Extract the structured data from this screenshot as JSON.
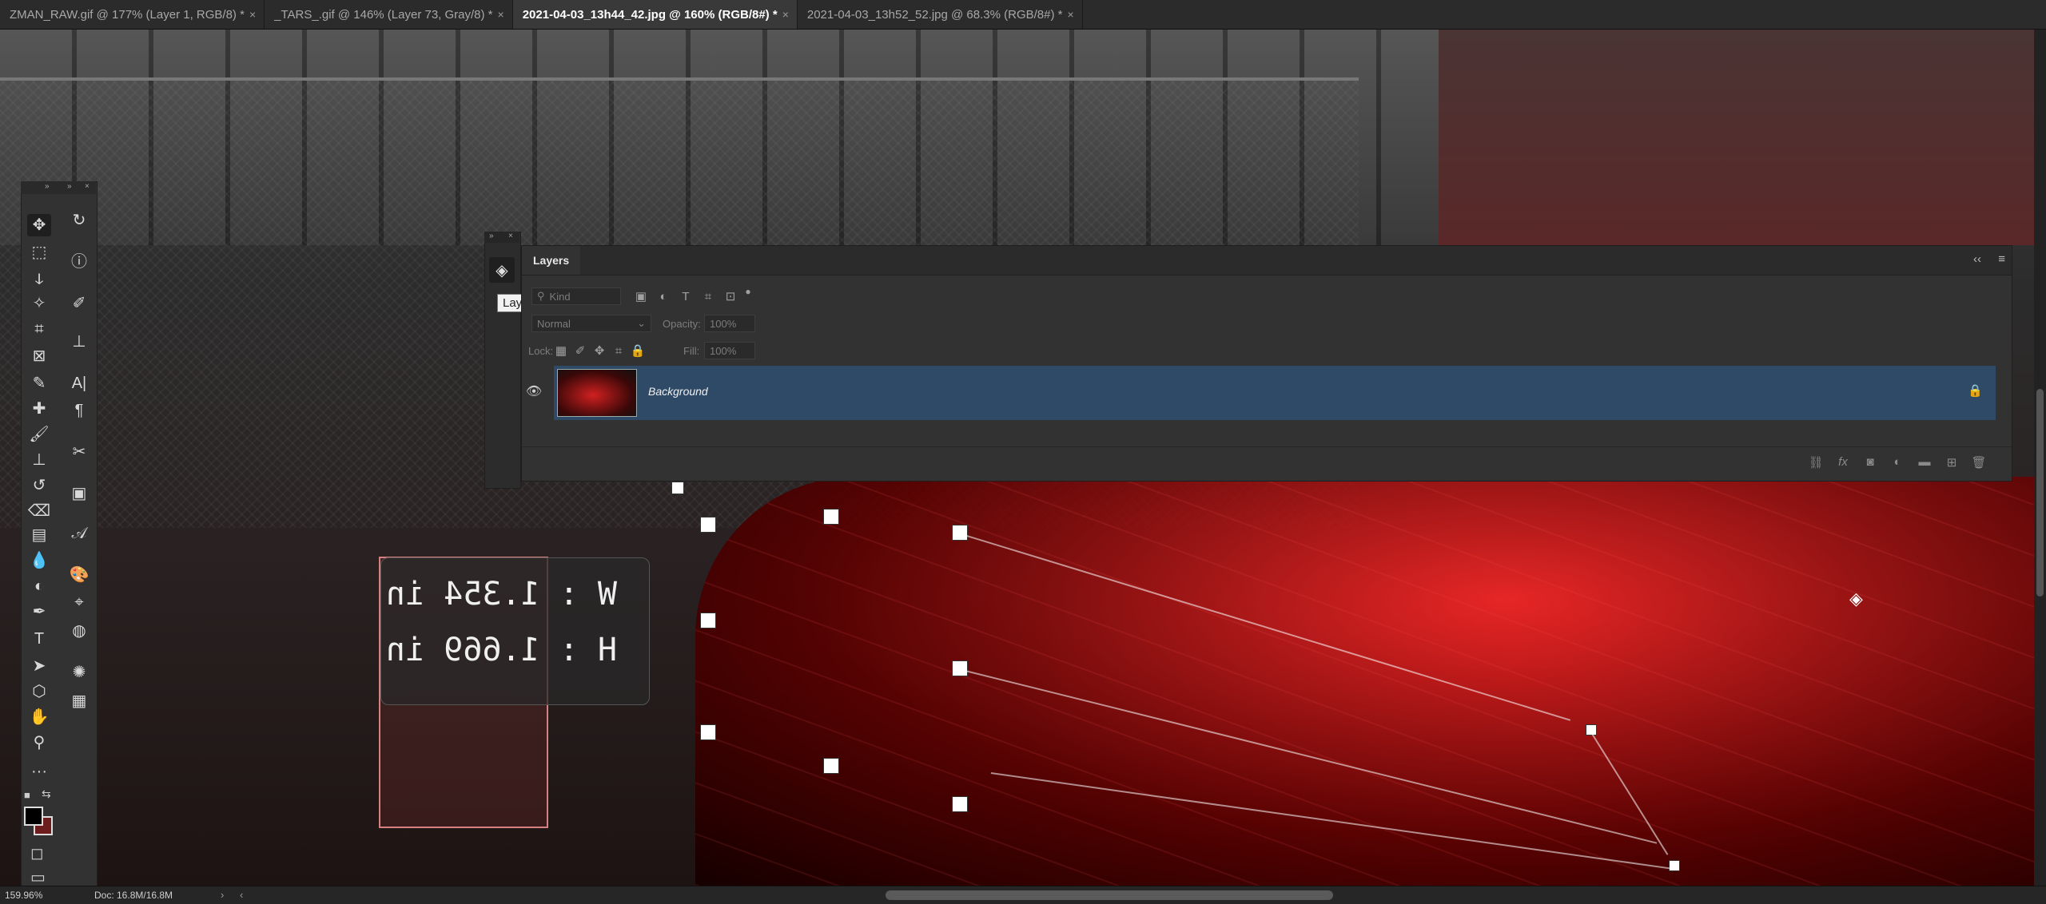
{
  "tabs": [
    {
      "label": "ZMAN_RAW.gif @ 177% (Layer 1, RGB/8) *",
      "close": "×",
      "active": false
    },
    {
      "label": "_TARS_.gif @ 146% (Layer 73, Gray/8) *",
      "close": "×",
      "active": false
    },
    {
      "label": "2021-04-03_13h44_42.jpg @ 160% (RGB/8#) *",
      "close": "×",
      "active": true
    },
    {
      "label": "2021-04-03_13h52_52.jpg @ 68.3% (RGB/8#) *",
      "close": "×",
      "active": false
    }
  ],
  "canvas": {
    "transform_readout": {
      "w_label": "W",
      "w_value": "1.354 in",
      "h_label": "H",
      "h_value": "1.669 in",
      "separator": ":"
    }
  },
  "toolbar": {
    "collapse_glyph": "»",
    "close_glyph": "×",
    "tools_left": [
      {
        "name": "move-tool-icon",
        "glyph": "✥"
      },
      {
        "name": "marquee-tool-icon",
        "glyph": "⬚"
      },
      {
        "name": "lasso-tool-icon",
        "glyph": "ↆ"
      },
      {
        "name": "magic-wand-tool-icon",
        "glyph": "✧"
      },
      {
        "name": "crop-tool-icon",
        "glyph": "⌗"
      },
      {
        "name": "frame-tool-icon",
        "glyph": "⊠"
      },
      {
        "name": "eyedropper-tool-icon",
        "glyph": "✎"
      },
      {
        "name": "healing-brush-tool-icon",
        "glyph": "✚"
      },
      {
        "name": "brush-tool-icon",
        "glyph": "🖌"
      },
      {
        "name": "clone-stamp-tool-icon",
        "glyph": "⊥"
      },
      {
        "name": "history-brush-tool-icon",
        "glyph": "↺"
      },
      {
        "name": "eraser-tool-icon",
        "glyph": "⌫"
      },
      {
        "name": "gradient-tool-icon",
        "glyph": "▤"
      },
      {
        "name": "blur-tool-icon",
        "glyph": "💧"
      },
      {
        "name": "dodge-tool-icon",
        "glyph": "◐"
      },
      {
        "name": "pen-tool-icon",
        "glyph": "✒"
      },
      {
        "name": "type-tool-icon",
        "glyph": "T"
      },
      {
        "name": "path-selection-tool-icon",
        "glyph": "➤"
      },
      {
        "name": "shape-tool-icon",
        "glyph": "⬡"
      },
      {
        "name": "hand-tool-icon",
        "glyph": "✋"
      },
      {
        "name": "zoom-tool-icon",
        "glyph": "⚲"
      },
      {
        "name": "more-tools-icon",
        "glyph": "···"
      }
    ],
    "tools_right": [
      {
        "name": "history-panel-icon",
        "glyph": "↻"
      },
      {
        "name": "info-panel-icon",
        "glyph": "ⓘ"
      },
      {
        "name": "brush-settings-icon",
        "glyph": "✐"
      },
      {
        "name": "clone-source-icon",
        "glyph": "⊥"
      },
      {
        "name": "character-panel-icon",
        "glyph": "A|"
      },
      {
        "name": "paragraph-panel-icon",
        "glyph": "¶"
      },
      {
        "name": "tool-presets-icon",
        "glyph": "✂"
      },
      {
        "name": "notes-panel-icon",
        "glyph": "▣"
      },
      {
        "name": "glyphs-panel-icon",
        "glyph": "𝒜"
      },
      {
        "name": "color-palette-icon",
        "glyph": "🎨"
      },
      {
        "name": "paths-panel-icon",
        "glyph": "⌖"
      },
      {
        "name": "channels-panel-icon",
        "glyph": "◍"
      },
      {
        "name": "adjustments-panel-icon",
        "glyph": "✺"
      },
      {
        "name": "grid-panel-icon",
        "glyph": "▦"
      }
    ],
    "swap_glyph": "⇆",
    "quick_mask_glyph": "◻",
    "screen_mode_glyph": "▭"
  },
  "dock": {
    "collapse_glyph": "»",
    "close_glyph": "×",
    "layers_glyph": "◈",
    "tooltip": "Layers"
  },
  "layers_panel": {
    "title": "Layers",
    "collapse_glyph": "‹‹",
    "menu_glyph": "≡",
    "filter": {
      "kind_placeholder": "Kind"
    },
    "blend_mode": "Normal",
    "opacity_label": "Opacity:",
    "opacity_value": "100%",
    "lock_label": "Lock:",
    "fill_label": "Fill:",
    "fill_value": "100%",
    "layers": [
      {
        "name": "Background",
        "visible": true,
        "locked": true
      }
    ],
    "footer_icons": [
      "link-icon",
      "fx-icon",
      "mask-icon",
      "adjustment-icon",
      "folder-icon",
      "new-layer-icon",
      "trash-icon"
    ],
    "fx_glyph": "fx"
  },
  "statusbar": {
    "zoom": "159.96%",
    "doc": "Doc: 16.8M/16.8M",
    "arrow": "›",
    "left_arrow": "‹"
  },
  "colors": {
    "foreground": "#000000",
    "background": "#6d1d1d",
    "selected_layer": "#2f4a66"
  }
}
